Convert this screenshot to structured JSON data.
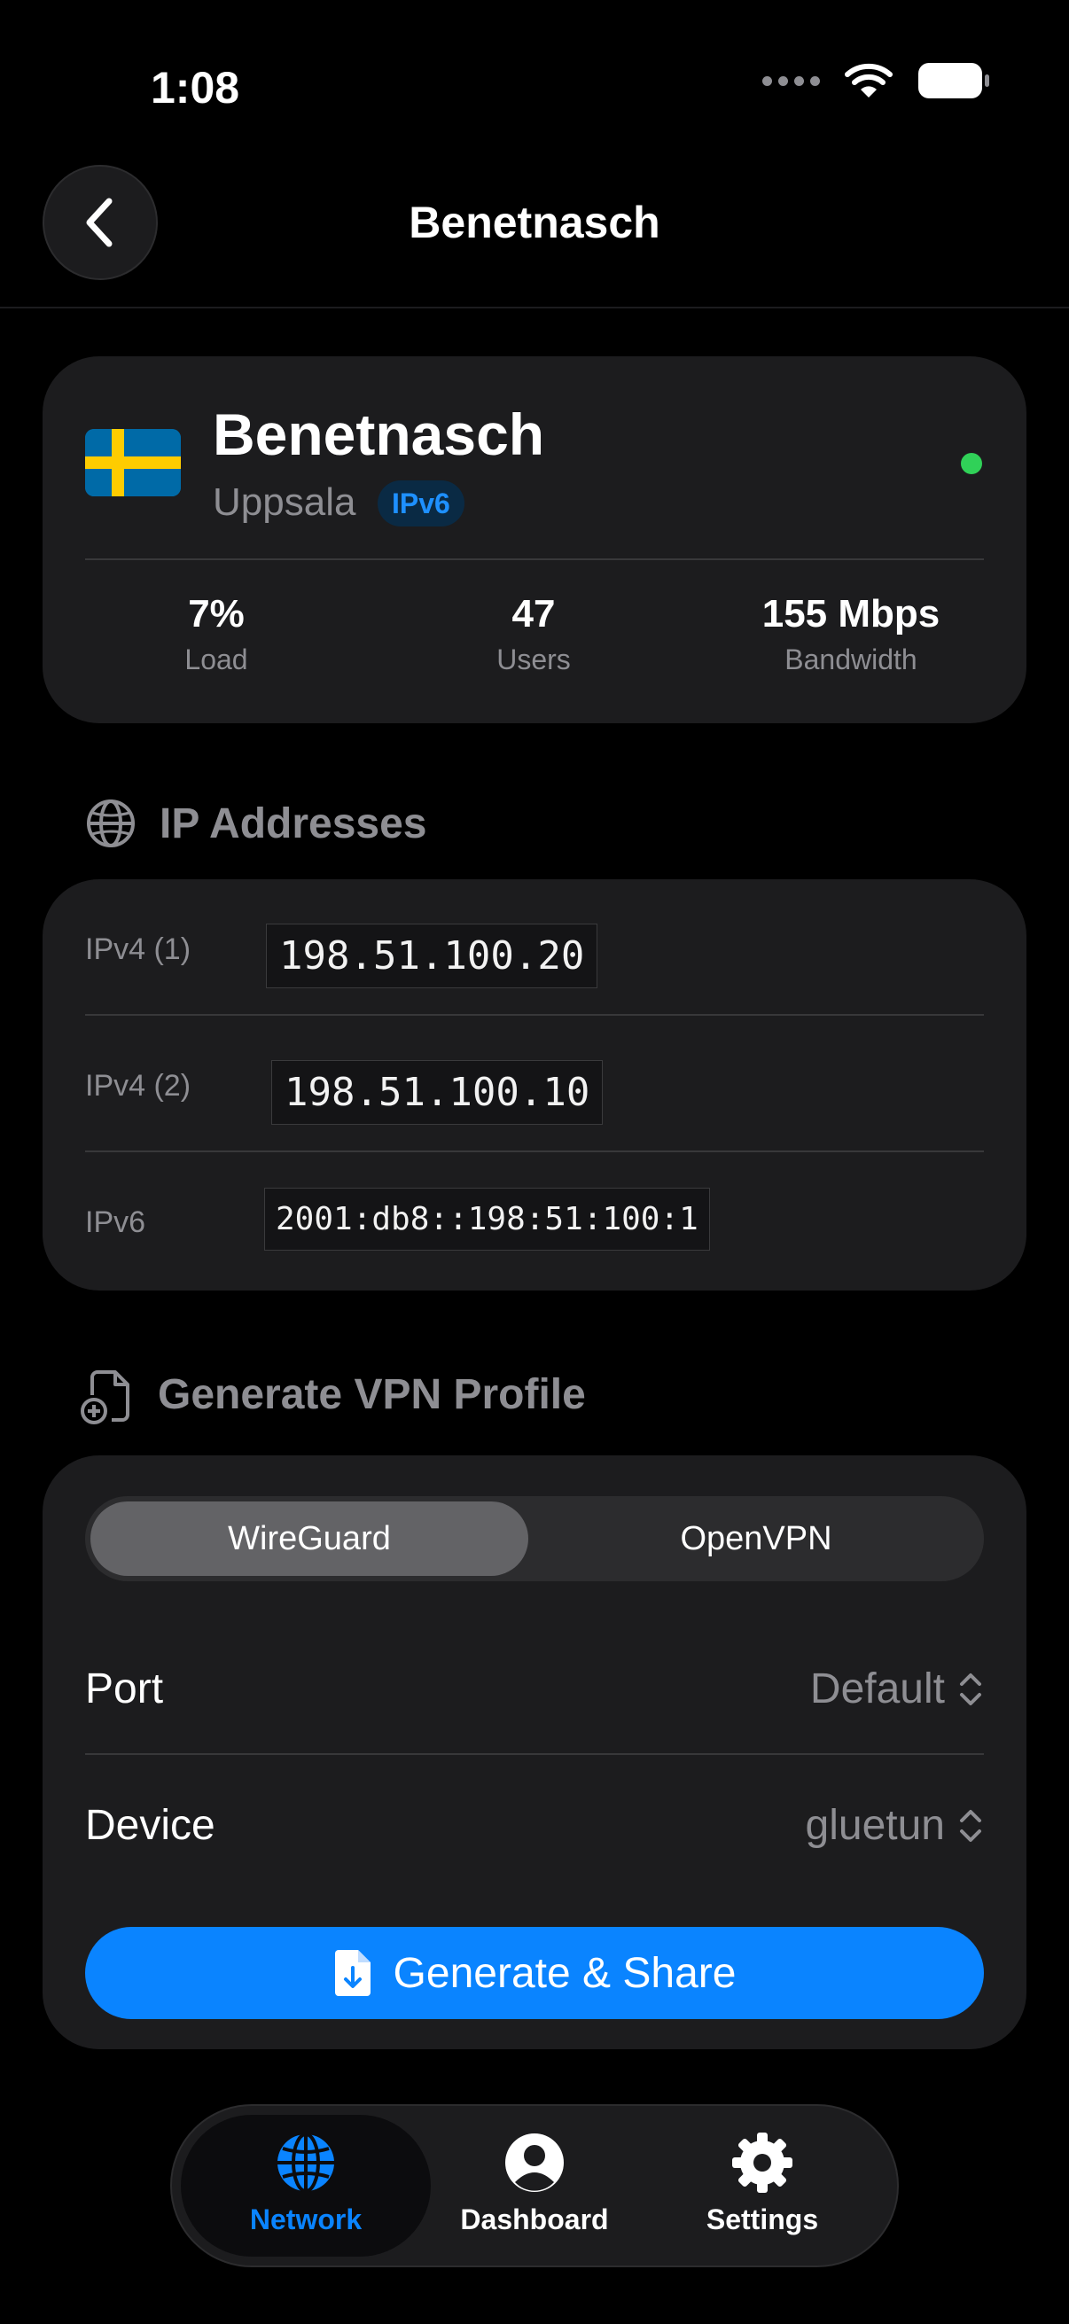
{
  "status_bar": {
    "time": "1:08"
  },
  "nav": {
    "title": "Benetnasch"
  },
  "server": {
    "name": "Benetnasch",
    "city": "Uppsala",
    "badge": "IPv6",
    "stats": [
      {
        "value": "7%",
        "label": "Load"
      },
      {
        "value": "47",
        "label": "Users"
      },
      {
        "value": "155 Mbps",
        "label": "Bandwidth"
      }
    ]
  },
  "ip_section": {
    "title": "IP Addresses",
    "rows": [
      {
        "label": "IPv4 (1)",
        "value": "198.51.100.20"
      },
      {
        "label": "IPv4 (2)",
        "value": "198.51.100.10"
      },
      {
        "label": "IPv6",
        "value": "2001:db8::198:51:100:1"
      }
    ]
  },
  "vpn_section": {
    "title": "Generate VPN Profile",
    "protocols": [
      "WireGuard",
      "OpenVPN"
    ],
    "selected_protocol": "WireGuard",
    "port": {
      "label": "Port",
      "value": "Default"
    },
    "device": {
      "label": "Device",
      "value": "gluetun"
    },
    "generate_label": "Generate & Share"
  },
  "tabs": [
    {
      "label": "Network",
      "icon": "globe-icon",
      "active": true
    },
    {
      "label": "Dashboard",
      "icon": "person-circle-icon",
      "active": false
    },
    {
      "label": "Settings",
      "icon": "gear-icon",
      "active": false
    }
  ],
  "colors": {
    "accent": "#0a84ff",
    "online": "#30d158",
    "card": "#1c1c1e",
    "background": "#000000"
  }
}
